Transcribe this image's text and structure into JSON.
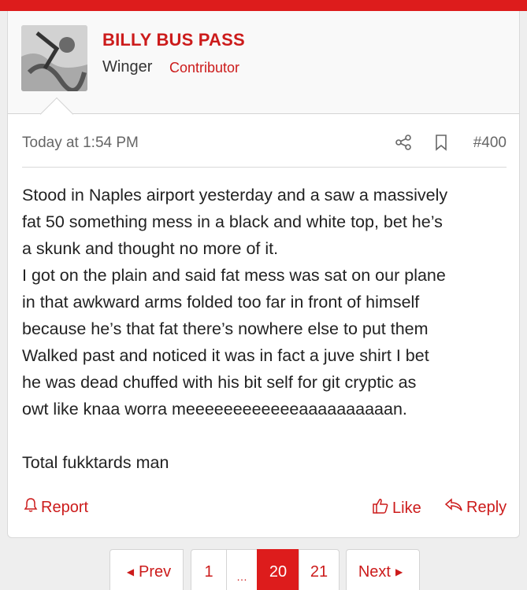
{
  "post": {
    "username": "BILLY BUS PASS",
    "user_title": "Winger",
    "user_badge": "Contributor",
    "timestamp": "Today at 1:54 PM",
    "post_number": "#400",
    "body_lines": [
      "Stood in Naples airport yesterday and a saw a massively",
      "fat 50 something mess in a black and white top, bet he’s",
      "a skunk and thought no more of it.",
      "I got on the plain and said fat mess was sat on our plane",
      "in that awkward arms folded too far in front of himself",
      "because he’s that fat there’s nowhere else to put them",
      "Walked past and noticed it was in fact a juve shirt I bet",
      "he was dead chuffed with his bit self for git cryptic as",
      "owt like knaa worra meeeeeeeeeeeeaaaaaaaaaan."
    ],
    "closing_line": "Total fukktards man",
    "actions": {
      "report": "Report",
      "like": "Like",
      "reply": "Reply"
    }
  },
  "pagination": {
    "prev": "Prev",
    "pages": [
      "1",
      "…",
      "20",
      "21"
    ],
    "current": "20",
    "next": "Next"
  },
  "colors": {
    "accent": "#dd1c1c",
    "link": "#cc1b1b"
  },
  "icons": [
    "share-icon",
    "bookmark-icon",
    "bell-icon",
    "thumbs-up-icon",
    "reply-arrow-icon",
    "caret-left-icon",
    "caret-right-icon"
  ]
}
